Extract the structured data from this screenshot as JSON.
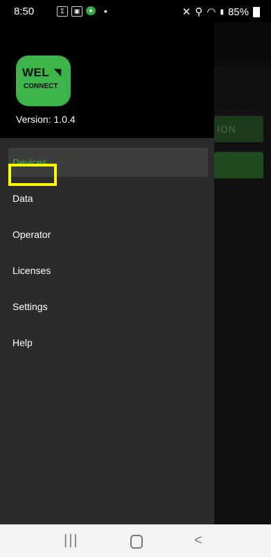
{
  "status_bar": {
    "time": "8:50",
    "notification_icons": [
      "sigma-icon",
      "image-icon",
      "app-icon"
    ],
    "dot": "•",
    "battery_percent": "85%"
  },
  "background": {
    "button1_label": "ION"
  },
  "drawer": {
    "logo_text_top": "WEL",
    "logo_text_bottom": "CONNECT",
    "version": "Version: 1.0.4",
    "items": [
      {
        "label": "Devices",
        "active": true
      },
      {
        "label": "Data",
        "active": false,
        "highlighted": true
      },
      {
        "label": "Operator",
        "active": false
      },
      {
        "label": "Licenses",
        "active": false
      },
      {
        "label": "Settings",
        "active": false
      },
      {
        "label": "Help",
        "active": false
      }
    ]
  },
  "system_nav": {
    "recents": "|||",
    "back": "<"
  },
  "colors": {
    "accent": "#4caf50",
    "logo": "#3cb44a",
    "highlight": "#ffff00",
    "drawer_bg": "#2b2b2b"
  }
}
